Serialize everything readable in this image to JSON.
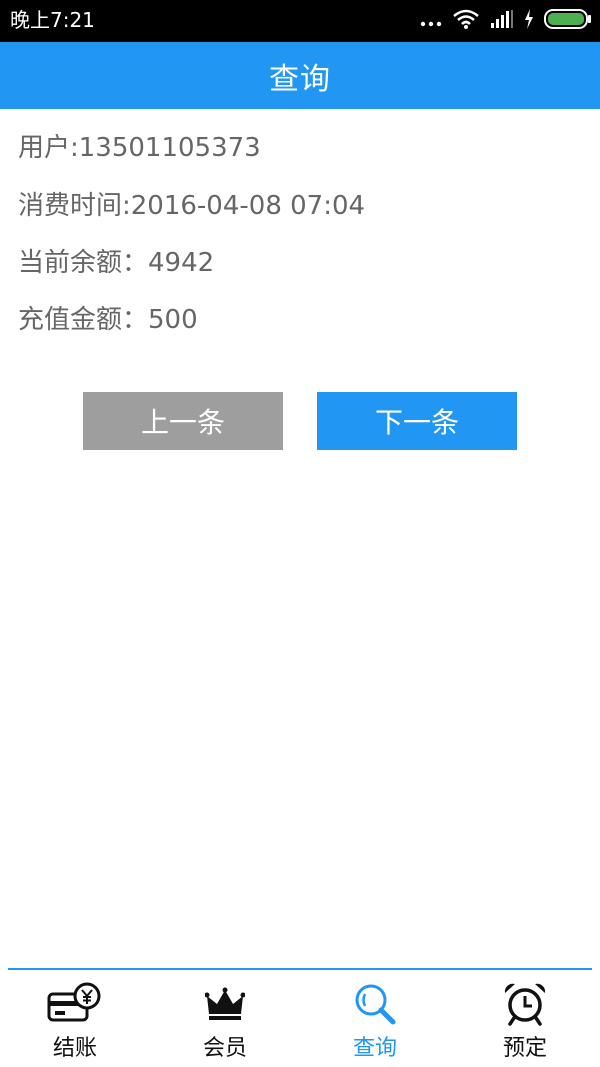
{
  "status_bar": {
    "time": "晚上7:21",
    "icons": [
      "more-dots-icon",
      "wifi-icon",
      "signal-icon",
      "charging-icon",
      "battery-icon"
    ]
  },
  "header": {
    "title": "查询"
  },
  "record": {
    "user": "用户:13501105373",
    "consume_time": "消费时间:2016-04-08 07:04",
    "balance": "当前余额：4942",
    "recharge": "充值金额：500"
  },
  "buttons": {
    "prev_label": "上一条",
    "next_label": "下一条"
  },
  "tabs": [
    {
      "label": "结账",
      "icon": "card-yen-icon",
      "active": false
    },
    {
      "label": "会员",
      "icon": "crown-icon",
      "active": false
    },
    {
      "label": "查询",
      "icon": "search-icon",
      "active": true
    },
    {
      "label": "预定",
      "icon": "alarm-clock-icon",
      "active": false
    }
  ],
  "colors": {
    "accent": "#2196f3",
    "button_disabled": "#9e9e9e",
    "text_gray": "#666666",
    "battery_green": "#4caf50"
  }
}
